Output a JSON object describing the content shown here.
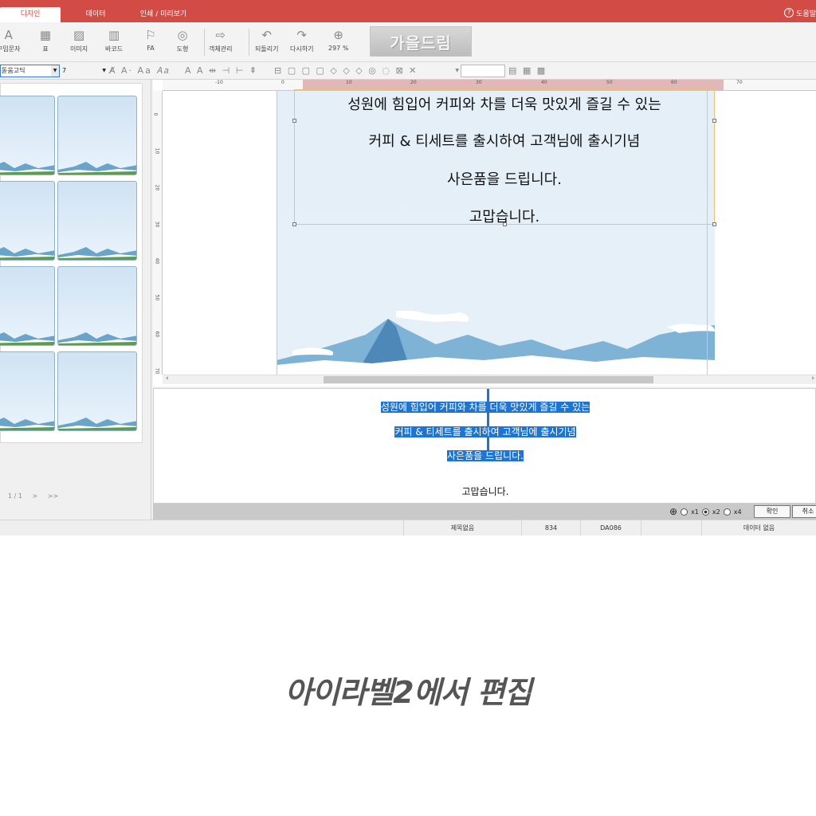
{
  "tabs": [
    {
      "label": "디자인",
      "active": true
    },
    {
      "label": "데이터",
      "active": false
    },
    {
      "label": "인쇄 / 미리보기",
      "active": false
    }
  ],
  "help_label": "도움말",
  "ribbon": {
    "items": [
      {
        "label": "꾸밈문자",
        "icon": "decorated-text-icon"
      },
      {
        "label": "표",
        "icon": "table-icon"
      },
      {
        "label": "이미지",
        "icon": "image-icon"
      },
      {
        "label": "바코드",
        "icon": "barcode-icon"
      },
      {
        "label": "FA",
        "icon": "fa-icon"
      },
      {
        "label": "도형",
        "icon": "shape-icon"
      },
      {
        "label": "객체관리",
        "icon": "object-manage-icon"
      },
      {
        "label": "되돌리기",
        "icon": "undo-icon"
      },
      {
        "label": "다시하기",
        "icon": "redo-icon"
      },
      {
        "label": "297 %",
        "icon": "zoom-icon"
      }
    ],
    "logo_text": "가을드림"
  },
  "format": {
    "font_name": "돋움고딕",
    "font_size": "7"
  },
  "left_panel": {
    "page_indicator": "1 / 1",
    "next": ">",
    "last": ">>"
  },
  "ruler": {
    "h_labels": [
      "-10",
      "0",
      "10",
      "20",
      "30",
      "40",
      "50",
      "60",
      "70"
    ],
    "v_labels": [
      "0",
      "10",
      "20",
      "30",
      "40",
      "50",
      "60",
      "70"
    ]
  },
  "canvas": {
    "lines": [
      "성원에 힘입어 커피와 차를 더욱 맛있게 즐길 수 있는",
      "커피 & 티세트를 출시하여 고객님에 출시기념",
      "사은품을 드립니다.",
      "고맙습니다."
    ]
  },
  "editor": {
    "lines": [
      "성원에 힘입어 커피와 차를 더욱 맛있게 즐길 수 있는",
      "커피 & 티세트를 출시하여 고객님에 출시기념",
      "사은품을 드립니다.",
      "고맙습니다."
    ],
    "highlight_color": "#1e74d0"
  },
  "zoom_options": {
    "x1": "x1",
    "x2": "x2",
    "x4": "x4",
    "selected": "x2",
    "confirm": "확인",
    "cancel": "취소"
  },
  "status": {
    "title": "제목없음",
    "count": "834",
    "code": "DA086",
    "data": "데이터 없음"
  },
  "caption": "아이라벨2에서 편집",
  "colors": {
    "accent": "#d24b45",
    "selection": "#1e74d0"
  }
}
